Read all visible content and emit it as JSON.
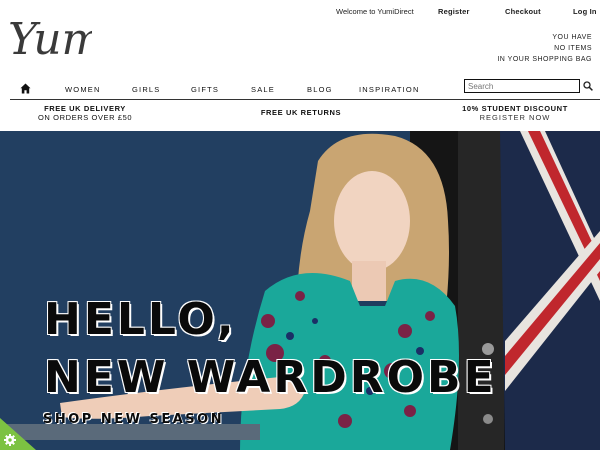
{
  "brand": {
    "logo_text": "Yumi"
  },
  "top_links": {
    "welcome": "Welcome to YumiDirect",
    "register": "Register",
    "checkout": "Checkout",
    "login": "Log In"
  },
  "bag": {
    "line1": "YOU HAVE",
    "line2": "NO ITEMS",
    "line3": "IN YOUR SHOPPING BAG"
  },
  "nav": {
    "home_icon": "home-icon",
    "items": [
      "WOMEN",
      "GIRLS",
      "GIFTS",
      "SALE",
      "BLOG",
      "INSPIRATION"
    ]
  },
  "search": {
    "placeholder": "Search",
    "icon": "search-icon"
  },
  "promos": {
    "delivery_title": "FREE UK DELIVERY",
    "delivery_sub": "ON ORDERS OVER £50",
    "returns": "FREE UK RETURNS",
    "student_title": "10% STUDENT DISCOUNT",
    "student_link": "REGISTER NOW"
  },
  "hero": {
    "line1": "HELLO,",
    "line2": "NEW WARDROBE",
    "cta": "SHOP NEW SEASON"
  },
  "colors": {
    "hero_backdrop": "#1f3d5e",
    "dress": "#1aa89a",
    "gear_tab": "#7cc242"
  }
}
